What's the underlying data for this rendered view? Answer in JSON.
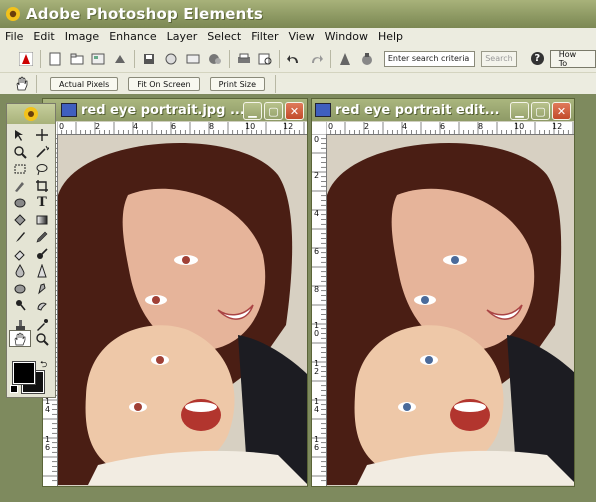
{
  "app": {
    "title": "Adobe Photoshop Elements"
  },
  "menu": [
    "File",
    "Edit",
    "Image",
    "Enhance",
    "Layer",
    "Select",
    "Filter",
    "View",
    "Window",
    "Help"
  ],
  "toolbar": {
    "search_placeholder": "Enter search criteria",
    "search_label": "Search",
    "howto_label": "How To"
  },
  "options": {
    "actual_pixels": "Actual Pixels",
    "fit_on_screen": "Fit On Screen",
    "print_size": "Print Size"
  },
  "documents": [
    {
      "title": "red eye portrait.jpg ...",
      "eye_color": "#a04036"
    },
    {
      "title": "red eye portrait edit...",
      "eye_color": "#4a6a9a"
    }
  ],
  "ruler": {
    "h_labels": [
      "0",
      "2",
      "4",
      "6",
      "8",
      "10",
      "12"
    ],
    "v_labels": [
      "0",
      "2",
      "4",
      "6",
      "8",
      "1\n0",
      "1\n2",
      "1\n4",
      "1\n6"
    ]
  },
  "colors": {
    "foreground": "#000000",
    "background": "#111111"
  }
}
